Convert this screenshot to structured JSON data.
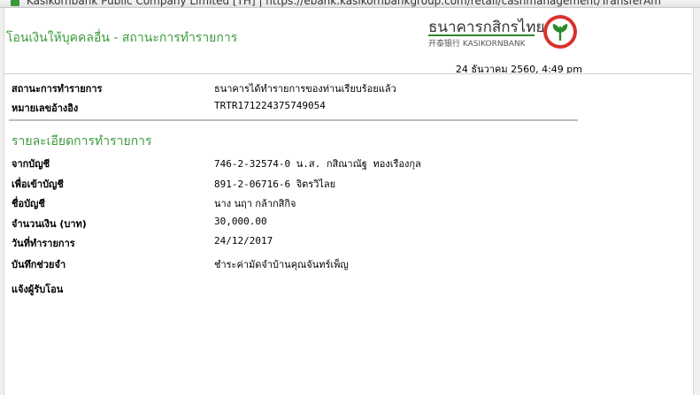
{
  "browser": {
    "url_fragment": "Kasikornbank Public Company Limited [TH] | https://ebank.kasikornbankgroup.com/retail/cashmanagement/TransferAm"
  },
  "header": {
    "title": "โอนเงินให้บุคคลอื่น - สถานะการทำรายการ",
    "logo_th": "ธนาคารกสิกรไทย",
    "logo_en": "开泰银行 KASIKORNBANK",
    "datetime": "24 ธันวาคม 2560, 4:49 pm"
  },
  "status": {
    "rows": [
      {
        "label": "สถานะการทำรายการ",
        "value": "ธนาคารได้ทำรายการของท่านเรียบร้อยแล้ว"
      },
      {
        "label": "หมายเลขอ้างอิง",
        "value": "TRTR171224375749054"
      }
    ]
  },
  "details": {
    "title": "รายละเอียดการทำรายการ",
    "rows": [
      {
        "label": "จากบัญชี",
        "value": "746-2-32574-0 น.ส. กสิณาณัฐ ทองเรืองกุล"
      },
      {
        "label": "เพื่อเข้าบัญชี",
        "value": "891-2-06716-6 จิตรวิไลย"
      },
      {
        "label": "ชื่อบัญชี",
        "value": "นาง นฤา กล้ากสิกิจ"
      },
      {
        "label": "จำนวนเงิน (บาท)",
        "value": "30,000.00"
      },
      {
        "label": "วันที่ทำรายการ",
        "value": "24/12/2017"
      },
      {
        "label": "บันทึกช่วยจำ",
        "value": "ชำระค่ามัดจำบ้านคุณจันทร์เพ็ญ"
      },
      {
        "label": "แจ้งผู้รับโอน",
        "value": ""
      }
    ]
  },
  "colors": {
    "accent_green": "#3c9a3c",
    "logo_red": "#d9312b",
    "logo_green": "#2a8a2a"
  }
}
